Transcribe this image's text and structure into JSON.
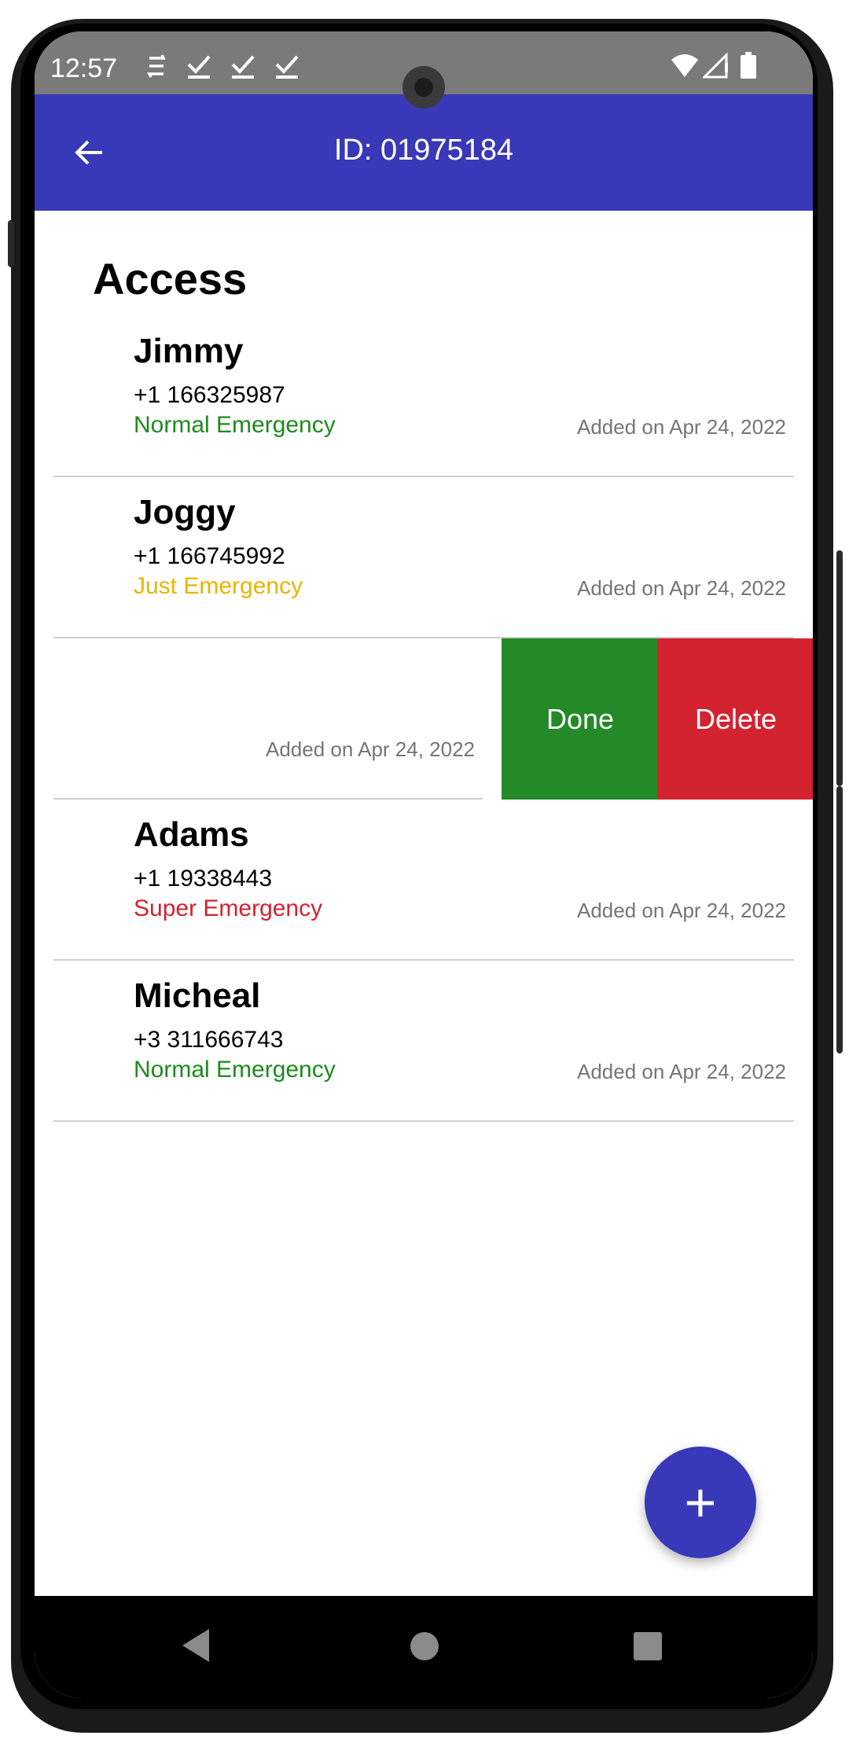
{
  "status_bar": {
    "time": "12:57",
    "icons": [
      "sync-icon",
      "check-icon",
      "check-icon",
      "check-icon",
      "wifi-icon",
      "signal-icon",
      "battery-icon"
    ]
  },
  "app_bar": {
    "title": "ID: 01975184",
    "back_icon": "arrow-left-icon",
    "background": "#3838b8"
  },
  "page": {
    "heading": "Access"
  },
  "contacts": [
    {
      "name": "Jimmy",
      "phone": "+1 166325987",
      "level": "Normal Emergency",
      "level_color": "#1e8a1e",
      "added": "Added on Apr 24, 2022"
    },
    {
      "name": "Joggy",
      "phone": "+1 166745992",
      "level": "Just Emergency",
      "level_color": "#e8b400",
      "added": "Added on Apr 24, 2022"
    },
    {
      "name": "",
      "phone": "",
      "level": "",
      "level_color": "",
      "added": "Added on Apr 24, 2022",
      "swiped": true,
      "actions": [
        {
          "label": "Done",
          "color": "#238a27"
        },
        {
          "label": "Delete",
          "color": "#d32230"
        }
      ]
    },
    {
      "name": "Adams",
      "phone": "+1 19338443",
      "level": "Super Emergency",
      "level_color": "#d32230",
      "added": "Added on Apr 24, 2022"
    },
    {
      "name": "Micheal",
      "phone": "+3 311666743",
      "level": "Normal Emergency",
      "level_color": "#1e8a1e",
      "added": "Added on Apr 24, 2022"
    }
  ],
  "fab": {
    "label": "+",
    "icon": "plus-icon"
  },
  "nav_bar": {
    "buttons": [
      "back-triangle-icon",
      "home-circle-icon",
      "recents-square-icon"
    ]
  }
}
